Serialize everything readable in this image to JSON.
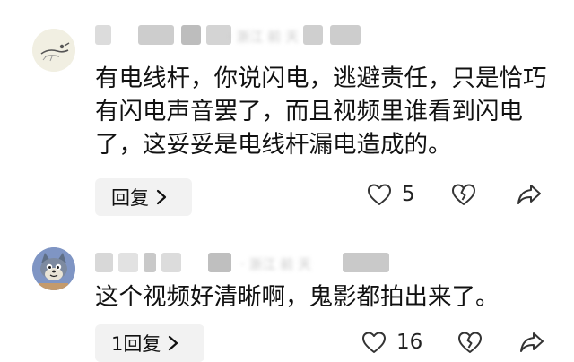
{
  "comments": [
    {
      "text": "有电线杆，你说闪电，逃避责任，只是恰巧有闪电声音罢了，而且视频里谁看到闪电了，这妥妥是电线杆漏电造成的。",
      "reply_label": "回复",
      "likes": "5",
      "meta_hint": "· 浙江 前 天",
      "avatar_icon": "sketch-avatar-icon"
    },
    {
      "text": "这个视频好清晰啊，鬼影都拍出来了。",
      "reply_label": "1回复",
      "likes": "16",
      "meta_hint": "· 浙江 前 天",
      "avatar_icon": "cartoon-cat-avatar-icon"
    }
  ],
  "icons": [
    "heart-icon",
    "broken-heart-icon",
    "share-arrow-icon",
    "chevron-right-icon"
  ],
  "colors": {
    "reply_bg": "#f2f2f2",
    "text": "#111111",
    "icon": "#333333",
    "redaction": "#c9c9c9"
  }
}
